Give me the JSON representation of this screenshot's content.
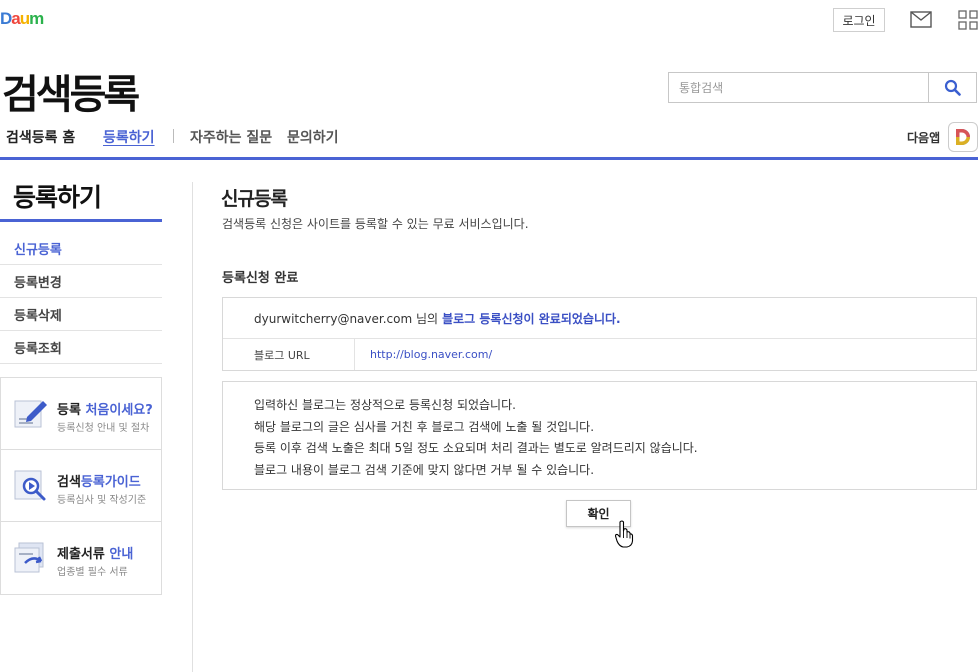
{
  "header": {
    "logo_text": "Daum",
    "login_label": "로그인",
    "mail_icon": "mail-icon",
    "apps_icon": "grid-icon"
  },
  "brand": {
    "title": "검색등록"
  },
  "search": {
    "placeholder": "통합검색",
    "button_icon": "search-icon"
  },
  "nav": {
    "home": "검색등록 홈",
    "register": "등록하기",
    "faq": "자주하는 질문",
    "contact": "문의하기",
    "daum_app": "다음앱"
  },
  "sidebar": {
    "title": "등록하기",
    "items": [
      {
        "label": "신규등록",
        "active": true
      },
      {
        "label": "등록변경",
        "active": false
      },
      {
        "label": "등록삭제",
        "active": false
      },
      {
        "label": "등록조회",
        "active": false
      }
    ],
    "cards": [
      {
        "title_plain": "등록 ",
        "title_highlight": "처음이세요?",
        "subtitle": "등록신청 안내 및 절차",
        "icon": "pencil-document-icon"
      },
      {
        "title_plain": "검색",
        "title_highlight": "등록가이드",
        "subtitle": "등록심사 및 작성기준",
        "icon": "magnifier-document-icon"
      },
      {
        "title_plain": "제출서류 ",
        "title_highlight": "안내",
        "subtitle": "업종별 필수 서류",
        "icon": "documents-arrow-icon"
      }
    ]
  },
  "main": {
    "title": "신규등록",
    "description": "검색등록 신청은 사이트를 등록할 수 있는 무료 서비스입니다.",
    "section_title": "등록신청 완료",
    "result": {
      "email_line": "dyurwitcherry@naver.com 님의",
      "done_text": "블로그 등록신청이 완료되었습니다.",
      "url_label": "블로그 URL",
      "url_value": "http://blog.naver.com/"
    },
    "notice_lines": [
      "입력하신 블로그는 정상적으로 등록신청 되었습니다.",
      "해당 블로그의 글은 심사를 거친 후 블로그 검색에 노출 될 것입니다.",
      "등록 이후 검색 노출은 최대 5일 정도 소요되며 처리 결과는 별도로 알려드리지 않습니다.",
      "블로그 내용이 블로그 검색 기준에 맞지 않다면 거부 될 수 있습니다."
    ],
    "confirm_label": "확인"
  },
  "colors": {
    "accent": "#4a63d4",
    "link": "#3a4fc4"
  }
}
